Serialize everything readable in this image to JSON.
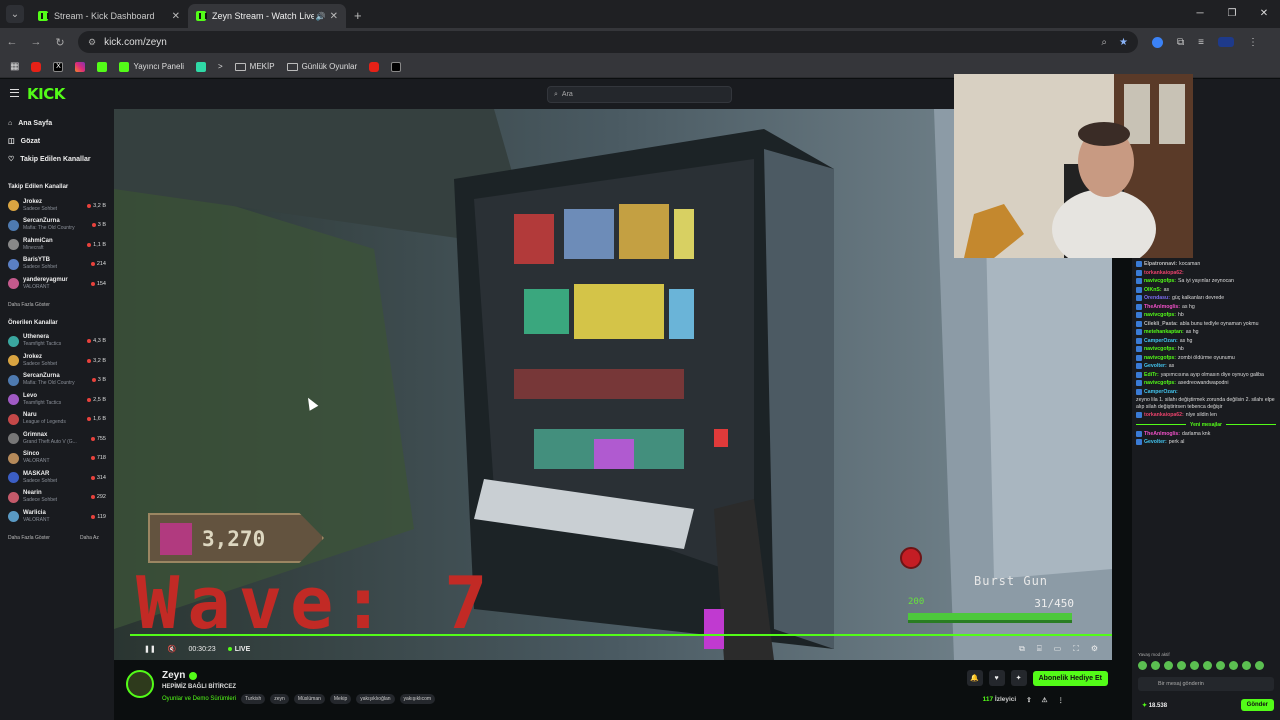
{
  "browser": {
    "tabs": [
      {
        "title": "Stream - Kick Dashboard"
      },
      {
        "title": "Zeyn Stream - Watch Live o"
      }
    ],
    "url": "kick.com/zeyn",
    "bookmarks": [
      "Yayıncı Paneli",
      "MEKİP",
      "Günlük Oyunlar"
    ]
  },
  "site": {
    "logo": "KICK",
    "search_placeholder": "Ara",
    "nav": [
      "Ana Sayfa",
      "Gözat",
      "Takip Edilen Kanallar"
    ]
  },
  "followed": {
    "heading": "Takip Edilen Kanallar",
    "channels": [
      {
        "name": "Jrokez",
        "cat": "Sadece Sohbet",
        "viewers": "3,2 B",
        "color": "#d9a441"
      },
      {
        "name": "SercanZurna",
        "cat": "Mafia: The Old Country",
        "viewers": "3 B",
        "color": "#4e7ab0"
      },
      {
        "name": "RahmiCan",
        "cat": "Minecraft",
        "viewers": "1,1 B",
        "color": "#888"
      },
      {
        "name": "BarisYTB",
        "cat": "Sadece Sohbet",
        "viewers": "214",
        "color": "#5a7fc4"
      },
      {
        "name": "yandereyagmur",
        "cat": "VALORANT",
        "viewers": "154",
        "color": "#c45a8d"
      }
    ],
    "more": "Daha Fazla Göster"
  },
  "recommended": {
    "heading": "Önerilen Kanallar",
    "channels": [
      {
        "name": "Uthenera",
        "cat": "Teamfight Tactics",
        "viewers": "4,3 B",
        "color": "#3aa7a0"
      },
      {
        "name": "Jrokez",
        "cat": "Sadece Sohbet",
        "viewers": "3,2 B",
        "color": "#d9a441"
      },
      {
        "name": "SercanZurna",
        "cat": "Mafia: The Old Country",
        "viewers": "3 B",
        "color": "#4e7ab0"
      },
      {
        "name": "Levo",
        "cat": "Teamfight Tactics",
        "viewers": "2,5 B",
        "color": "#a05ac4"
      },
      {
        "name": "Naru",
        "cat": "League of Legends",
        "viewers": "1,6 B",
        "color": "#c44848"
      },
      {
        "name": "Grimnax",
        "cat": "Grand Theft Auto V (G...",
        "viewers": "755",
        "color": "#777"
      },
      {
        "name": "Sinco",
        "cat": "VALORANT",
        "viewers": "718",
        "color": "#b58a5a"
      },
      {
        "name": "MASKAR",
        "cat": "Sadece Sohbet",
        "viewers": "314",
        "color": "#3b5ec4"
      },
      {
        "name": "Nearin",
        "cat": "Sadece Sohbet",
        "viewers": "292",
        "color": "#c45a6a"
      },
      {
        "name": "Warlicia",
        "cat": "VALORANT",
        "viewers": "119",
        "color": "#5a9ac4"
      }
    ],
    "more": "Daha Fazla Göster",
    "less": "Daha Az"
  },
  "game": {
    "score": "3,270",
    "wave_label": "Wave:",
    "wave_number": "7",
    "gun": "Burst Gun",
    "hp": "200",
    "ammo": "31/450"
  },
  "player": {
    "time": "00:30:23",
    "live": "LIVE"
  },
  "stream": {
    "name": "Zeyn",
    "title": "HEPİMİZ BAĞLI BİTİRCEZ",
    "category": "Oyunlar ve Demo Sürümleri",
    "tags": [
      "Turkish",
      "zeyn",
      "Müslüman",
      "Mekip",
      "yakışıklıoğlan",
      "yakışıklıcom"
    ],
    "gift_button": "Abonelik Hediye Et",
    "viewers": "117",
    "viewers_label": "İzleyici"
  },
  "chat": {
    "messages": [
      {
        "user": "Elpatronnavi:",
        "text": "kocaman",
        "color": "#bbbbbb"
      },
      {
        "user": "torkankaiopa62:",
        "text": "",
        "color": "#e8426b"
      },
      {
        "user": "navivcgofps:",
        "text": "Sa iyi yayınlar zeynocan",
        "color": "#53fc18"
      },
      {
        "user": "OlKnS:",
        "text": "as",
        "color": "#53fc18"
      },
      {
        "user": "Orendasu:",
        "text": "güç kalkanları devrede",
        "color": "#7c6cf0"
      },
      {
        "user": "TheAnlmoglis:",
        "text": "as hg",
        "color": "#f050c8"
      },
      {
        "user": "navivcgofps:",
        "text": "hb",
        "color": "#53fc18"
      },
      {
        "user": "Cilekli_Pasta:",
        "text": "abla bunu tedlyle oynaman yokmu",
        "color": "#bbbbbb"
      },
      {
        "user": "metehankaptan:",
        "text": "as hg",
        "color": "#53fc18"
      },
      {
        "user": "CamperOzan:",
        "text": "as hg",
        "color": "#42c6f0"
      },
      {
        "user": "navivcgofps:",
        "text": "hb",
        "color": "#53fc18"
      },
      {
        "user": "navivcgofps:",
        "text": "zombi öldürme oyunumu",
        "color": "#53fc18"
      },
      {
        "user": "Gevolter:",
        "text": "as",
        "color": "#42c6f0"
      },
      {
        "user": "EdiTr:",
        "text": "yapımcısına ayıp olmasın diye oynuyo galiba",
        "color": "#53fc18"
      },
      {
        "user": "navivcgofps:",
        "text": "asedreowandwapodni",
        "color": "#53fc18"
      },
      {
        "user": "CamperOzan:",
        "text": "zeyno lila 1. silahı değiştirmek zorunda değilsin 2. silahı elpe alıp silah değiştirirsen tebenca değişir",
        "color": "#42c6f0"
      },
      {
        "user": "torkankaiopa62:",
        "text": "nlye sildin len",
        "color": "#e8426b"
      }
    ],
    "new_label": "Yeni mesajlar",
    "new_messages": [
      {
        "user": "TheAnlmoglis:",
        "text": "darlama knk",
        "color": "#f050c8"
      },
      {
        "user": "Gevolter:",
        "text": "perk al",
        "color": "#42c6f0"
      }
    ],
    "slow_mode": "Yavaş mod aktif",
    "input_placeholder": "Bir mesaj gönderin",
    "points": "18.538",
    "send": "Gönder"
  }
}
